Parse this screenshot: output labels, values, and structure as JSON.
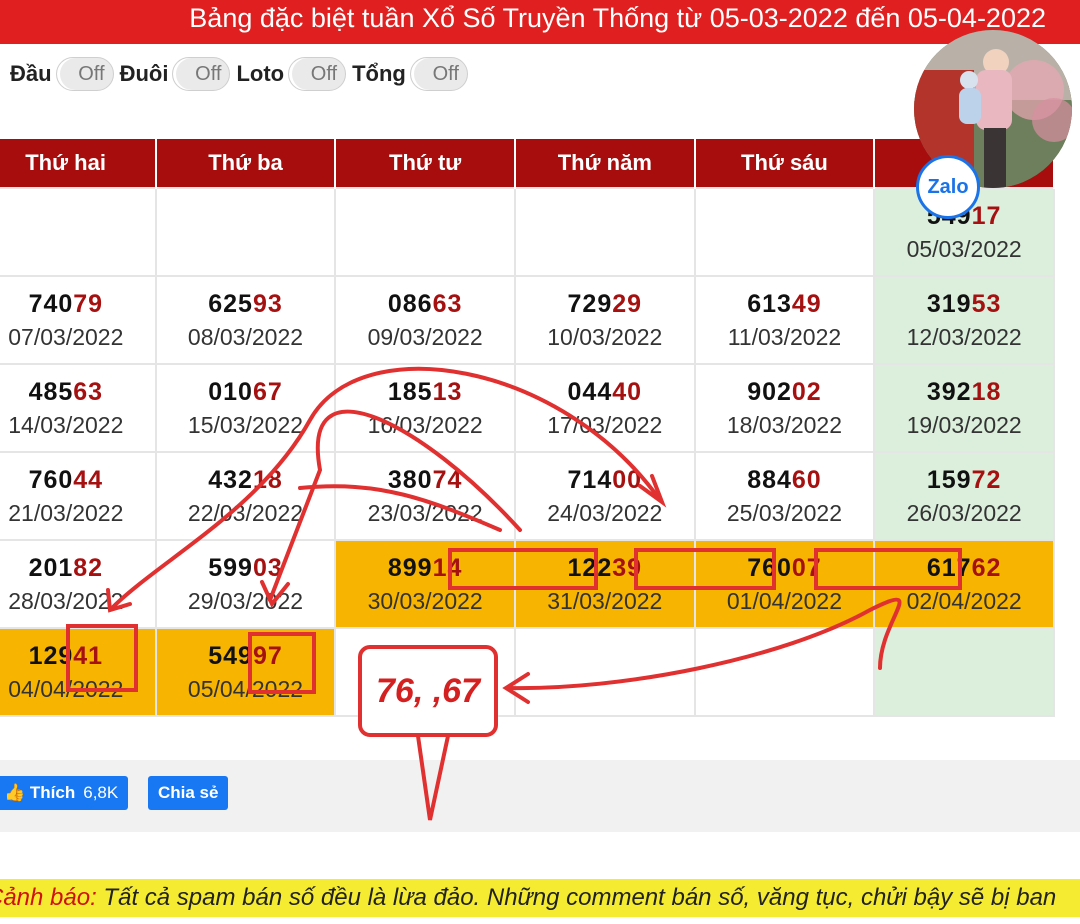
{
  "title": "Bảng đặc biệt tuần Xổ Số Truyền Thống từ 05-03-2022 đến 05-04-2022",
  "toggles": [
    {
      "label": "Đầu",
      "state": "Off"
    },
    {
      "label": "Đuôi",
      "state": "Off"
    },
    {
      "label": "Loto",
      "state": "Off"
    },
    {
      "label": "Tổng",
      "state": "Off"
    }
  ],
  "zalo_label": "Zalo",
  "headers": [
    "Thứ hai",
    "Thứ ba",
    "Thứ tư",
    "Thứ năm",
    "Thứ sáu",
    ""
  ],
  "rows": [
    [
      {
        "head": "",
        "tail": "",
        "date": ""
      },
      {
        "head": "",
        "tail": "",
        "date": ""
      },
      {
        "head": "",
        "tail": "",
        "date": ""
      },
      {
        "head": "",
        "tail": "",
        "date": ""
      },
      {
        "head": "",
        "tail": "",
        "date": ""
      },
      {
        "head": "549",
        "tail": "17",
        "date": "05/03/2022"
      }
    ],
    [
      {
        "head": "740",
        "tail": "79",
        "date": "07/03/2022"
      },
      {
        "head": "625",
        "tail": "93",
        "date": "08/03/2022"
      },
      {
        "head": "086",
        "tail": "63",
        "date": "09/03/2022"
      },
      {
        "head": "729",
        "tail": "29",
        "date": "10/03/2022"
      },
      {
        "head": "613",
        "tail": "49",
        "date": "11/03/2022"
      },
      {
        "head": "319",
        "tail": "53",
        "date": "12/03/2022"
      }
    ],
    [
      {
        "head": "485",
        "tail": "63",
        "date": "14/03/2022"
      },
      {
        "head": "010",
        "tail": "67",
        "date": "15/03/2022"
      },
      {
        "head": "185",
        "tail": "13",
        "date": "16/03/2022"
      },
      {
        "head": "044",
        "tail": "40",
        "date": "17/03/2022"
      },
      {
        "head": "902",
        "tail": "02",
        "date": "18/03/2022"
      },
      {
        "head": "392",
        "tail": "18",
        "date": "19/03/2022"
      }
    ],
    [
      {
        "head": "760",
        "tail": "44",
        "date": "21/03/2022"
      },
      {
        "head": "432",
        "tail": "18",
        "date": "22/03/2022"
      },
      {
        "head": "380",
        "tail": "74",
        "date": "23/03/2022"
      },
      {
        "head": "714",
        "tail": "00",
        "date": "24/03/2022"
      },
      {
        "head": "884",
        "tail": "60",
        "date": "25/03/2022"
      },
      {
        "head": "159",
        "tail": "72",
        "date": "26/03/2022"
      }
    ],
    [
      {
        "head": "201",
        "tail": "82",
        "date": "28/03/2022"
      },
      {
        "head": "599",
        "tail": "03",
        "date": "29/03/2022"
      },
      {
        "head": "899",
        "tail": "14",
        "date": "30/03/2022"
      },
      {
        "head": "122",
        "tail": "39",
        "date": "31/03/2022"
      },
      {
        "head": "760",
        "tail": "07",
        "date": "01/04/2022"
      },
      {
        "head": "617",
        "tail": "62",
        "date": "02/04/2022"
      }
    ],
    [
      {
        "head": "129",
        "tail": "41",
        "date": "04/04/2022"
      },
      {
        "head": "549",
        "tail": "97",
        "date": "05/04/2022"
      },
      {
        "head": "",
        "tail": "",
        "date": ""
      },
      {
        "head": "",
        "tail": "",
        "date": ""
      },
      {
        "head": "",
        "tail": "",
        "date": ""
      },
      {
        "head": "",
        "tail": "",
        "date": ""
      }
    ]
  ],
  "bubble_text": "76, ,67",
  "like_button": {
    "label": "Thích",
    "count": "6,8K"
  },
  "share_button": {
    "label": "Chia sẻ"
  },
  "warning": {
    "label": "Cảnh báo:",
    "text": " Tất cả spam bán số đều là lừa đảo. Những comment bán số, văng tục, chửi bậy sẽ bị ban"
  },
  "colors": {
    "title_bg": "#e02020",
    "header_bg": "#a80d0d",
    "highlight": "#f7b400",
    "weekend": "#dcefdc",
    "tail_digits": "#a51010",
    "annotation": "#e03030",
    "fb_blue": "#1877f2"
  }
}
